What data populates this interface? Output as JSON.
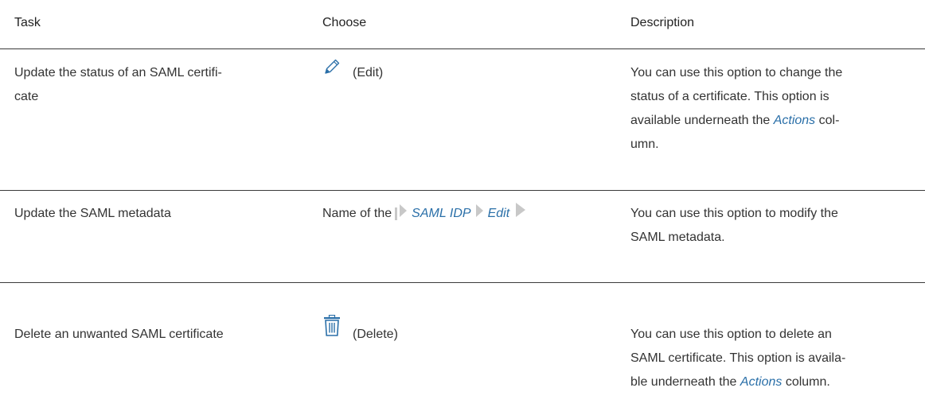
{
  "table": {
    "headers": {
      "task": "Task",
      "choose": "Choose",
      "description": "Description"
    },
    "rows": [
      {
        "task_lines": [
          "Update the status of an SAML certifi-",
          "cate"
        ],
        "choose_icon": "pencil-edit-icon",
        "choose_label": "(Edit)",
        "desc_lines": [
          "You can use this option to change the",
          "status of a certificate. This option is",
          "available underneath the",
          "Actions",
          " col-",
          "umn."
        ]
      },
      {
        "task_lines": [
          "Update the SAML metadata"
        ],
        "choose_prefix": "Name of the",
        "choose_path": [
          "SAML IDP",
          "Edit"
        ],
        "desc_lines": [
          "You can use this option to modify the",
          "SAML metadata."
        ]
      },
      {
        "task_lines": [
          "Delete an unwanted SAML certificate"
        ],
        "choose_icon": "trash-delete-icon",
        "choose_label": "(Delete)",
        "desc_lines": [
          "You can use this option to delete an",
          "SAML certificate. This option is availa-",
          "ble underneath the",
          "Actions",
          " column."
        ]
      }
    ]
  },
  "colors": {
    "text": "#333333",
    "link": "#2a6fa8",
    "icon": "#2a6fa8",
    "rule": "#3a3a3a",
    "arrow": "#c8c8c8"
  }
}
